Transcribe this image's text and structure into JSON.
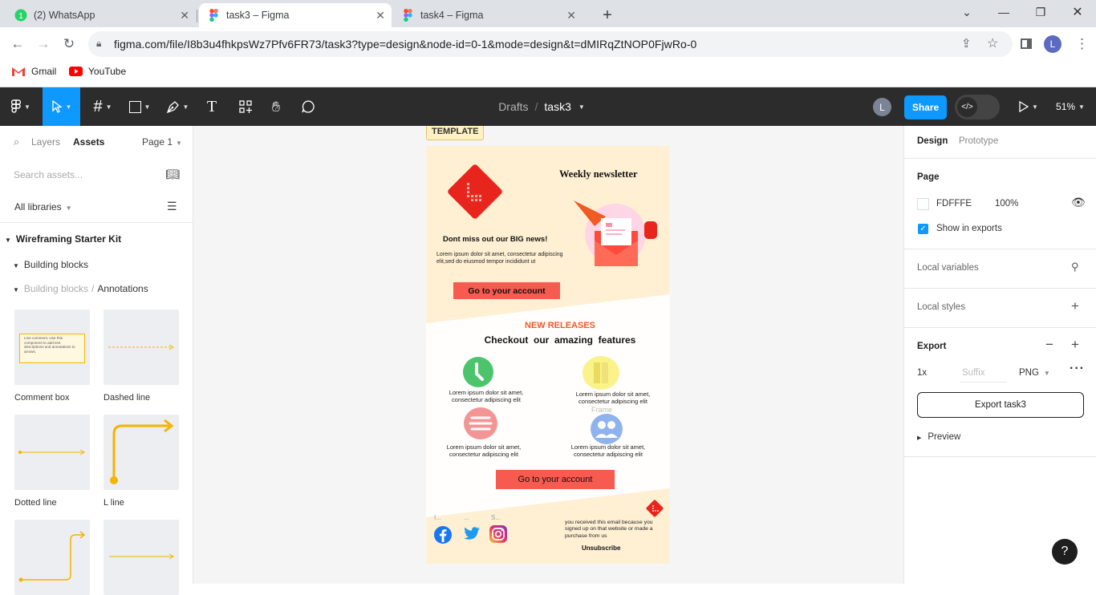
{
  "browser": {
    "tabs": [
      {
        "title": "(2) WhatsApp",
        "badge": "1"
      },
      {
        "title": "task3 – Figma"
      },
      {
        "title": "task4 – Figma"
      }
    ],
    "url": "figma.com/file/I8b3u4fhkpsWz7Pfv6FR73/task3?type=design&node-id=0-1&mode=design&t=dMIRqZtNOP0FjwRo-0",
    "profile_initial": "L",
    "bookmarks": [
      {
        "label": "Gmail"
      },
      {
        "label": "YouTube"
      }
    ]
  },
  "toolbar": {
    "breadcrumb_drafts": "Drafts",
    "breadcrumb_sep": "/",
    "file_name": "task3",
    "user_initial": "L",
    "share_label": "Share",
    "zoom": "51%"
  },
  "left_panel": {
    "tab_layers": "Layers",
    "tab_assets": "Assets",
    "page_selector": "Page 1",
    "search_placeholder": "Search assets...",
    "libraries": "All libraries",
    "kit_name": "Wireframing Starter Kit",
    "group_building_blocks": "Building blocks",
    "breadcrumb_parent": "Building blocks",
    "breadcrumb_sep": "/",
    "breadcrumb_current": "Annotations",
    "comment_thumb_text": "Line comment. Use this component to add text descriptions and annotations to arrows.",
    "assets": [
      {
        "label": "Comment box"
      },
      {
        "label": "Dashed line"
      },
      {
        "label": "Dotted line"
      },
      {
        "label": "L line"
      }
    ]
  },
  "canvas": {
    "frame_tag": "TEMPLATE",
    "newsletter_title": "Weekly newsletter",
    "headline": "Dont miss out our BIG news!",
    "body": "Lorem ipsum dolor sit amet, consectetur adipiscing elit,sed do eiusmod tempor incididunt ut",
    "cta1": "Go to your account",
    "new_releases": "NEW RELEASES",
    "features_title": "Checkout  our  amazing  features",
    "features": [
      {
        "line1": "Lorem ipsum dolor sit amet,",
        "line2": "consectetur adipiscing elit"
      },
      {
        "line1": "Lorem ipsum dolor sit amet,",
        "line2": "consectetur adipiscing elit"
      },
      {
        "line1": "Lorem ipsum dolor sit amet,",
        "line2": "consectetur adipiscing elit"
      },
      {
        "line1": "Lorem ipsum dolor sit amet,",
        "line2": "consectetur adipiscing elit"
      }
    ],
    "frame_label": "Frame",
    "cta2": "Go to your account",
    "social_labels": [
      "I...",
      "...",
      "S..."
    ],
    "footer_text": "you received this email because you signed up  on that website or made a purchase from us",
    "unsubscribe": "Unsubscribe",
    "colors": {
      "accent": "#f75a4f",
      "frame_bg": "#fff0d4",
      "orange": "#f05a23"
    }
  },
  "right_panel": {
    "tab_design": "Design",
    "tab_prototype": "Prototype",
    "page_title": "Page",
    "page_color": "FDFFFE",
    "page_opacity": "100%",
    "show_in_exports": "Show in exports",
    "local_variables": "Local variables",
    "local_styles": "Local styles",
    "export_title": "Export",
    "export_scale": "1x",
    "suffix_placeholder": "Suffix",
    "export_format": "PNG",
    "export_button": "Export task3",
    "preview": "Preview",
    "help": "?"
  }
}
